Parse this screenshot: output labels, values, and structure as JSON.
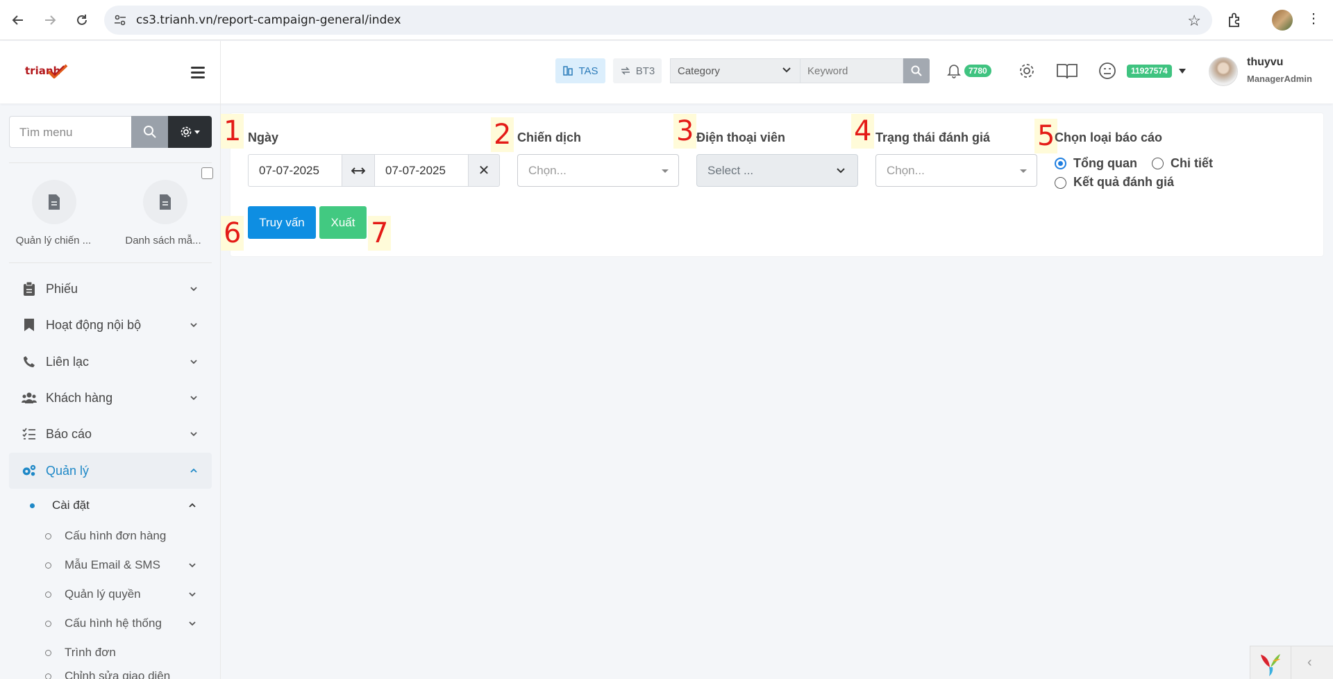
{
  "browser": {
    "url": "cs3.trianh.vn/report-campaign-general/index"
  },
  "header": {
    "logo_text": "trianh",
    "tas_label": "TAS",
    "bt3_label": "BT3",
    "category_placeholder": "Category",
    "keyword_placeholder": "Keyword",
    "notification_count": "7780",
    "balance": "11927574",
    "username": "thuyvu",
    "role": "ManagerAdmin"
  },
  "sidebar": {
    "search_placeholder": "Tìm menu",
    "shortcuts": [
      {
        "label": "Quản lý chiến ..."
      },
      {
        "label": "Danh sách mẫ..."
      }
    ],
    "menu": [
      {
        "label": "Phiếu"
      },
      {
        "label": "Hoạt động nội bộ"
      },
      {
        "label": "Liên lạc"
      },
      {
        "label": "Khách hàng"
      },
      {
        "label": "Báo cáo"
      },
      {
        "label": "Quản lý"
      }
    ],
    "submenu_parent": "Cài đặt",
    "submenu": [
      {
        "label": "Cấu hình đơn hàng"
      },
      {
        "label": "Mẫu Email & SMS"
      },
      {
        "label": "Quản lý quyền"
      },
      {
        "label": "Cấu hình hệ thống"
      },
      {
        "label": "Trình đơn"
      },
      {
        "label": "Chỉnh sửa giao diện"
      }
    ]
  },
  "form": {
    "markers": [
      "1",
      "2",
      "3",
      "4",
      "5",
      "6",
      "7"
    ],
    "date_label": "Ngày",
    "date_from": "07-07-2025",
    "date_to": "07-07-2025",
    "campaign_label": "Chiến dịch",
    "campaign_placeholder": "Chọn...",
    "agent_label": "Điện thoại viên",
    "agent_placeholder": "Select ...",
    "status_label": "Trạng thái đánh giá",
    "status_placeholder": "Chọn...",
    "report_type_label": "Chọn loại báo cáo",
    "report_types": [
      {
        "label": "Tổng quan",
        "checked": true
      },
      {
        "label": "Chi tiết",
        "checked": false
      },
      {
        "label": "Kết quả đánh giá",
        "checked": false
      }
    ],
    "query_button": "Truy vấn",
    "export_button": "Xuất"
  },
  "colors": {
    "primary": "#0e8ee2",
    "success": "#42c981",
    "marker": "#e41b17",
    "active_menu": "#1e88c7"
  }
}
